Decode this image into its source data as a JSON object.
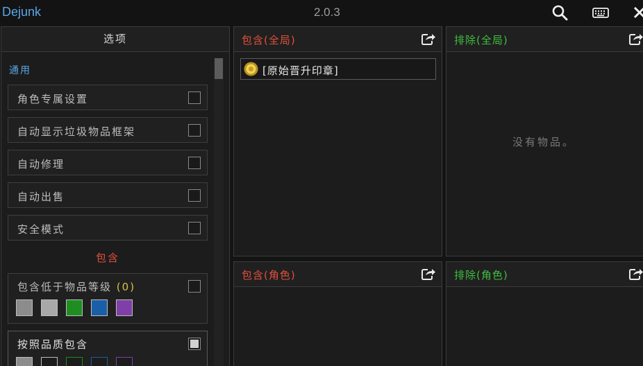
{
  "app": {
    "title": "Dejunk",
    "version": "2.0.3"
  },
  "titlebar_icons": {
    "search": "search-icon",
    "keybinds": "keyboard-icon",
    "close": "close-icon"
  },
  "options": {
    "header": "选项",
    "section_general": "通用",
    "rows": [
      {
        "label": "角色专属设置",
        "checked": false
      },
      {
        "label": "自动显示垃圾物品框架",
        "checked": false
      },
      {
        "label": "自动修理",
        "checked": false
      },
      {
        "label": "自动出售",
        "checked": false
      },
      {
        "label": "安全模式",
        "checked": false
      }
    ],
    "section_include": "包含",
    "below_ilvl": {
      "label": "包含低于物品等级",
      "count_open": "(",
      "count": "0",
      "count_close": ")",
      "checked": false
    },
    "by_quality": {
      "label": "按照品质包含",
      "checked": true
    },
    "quality_colors": [
      "#8c8c8c",
      "#a8a8a8",
      "#1e8e22",
      "#1a5ea8",
      "#7e3fa6"
    ]
  },
  "lists": {
    "include_global": {
      "title_main": "包含",
      "title_scope": "(全局)",
      "items": [
        "[原始晋升印章]"
      ]
    },
    "exclude_global": {
      "title_main": "排除",
      "title_scope": "(全局)",
      "empty_text": "没有物品。"
    },
    "include_char": {
      "title_main": "包含",
      "title_scope": "(角色)"
    },
    "exclude_char": {
      "title_main": "排除",
      "title_scope": "(角色)"
    }
  },
  "colors": {
    "include": "#e0503c",
    "exclude": "#3fbf3f",
    "accent": "#5aa6e6"
  }
}
